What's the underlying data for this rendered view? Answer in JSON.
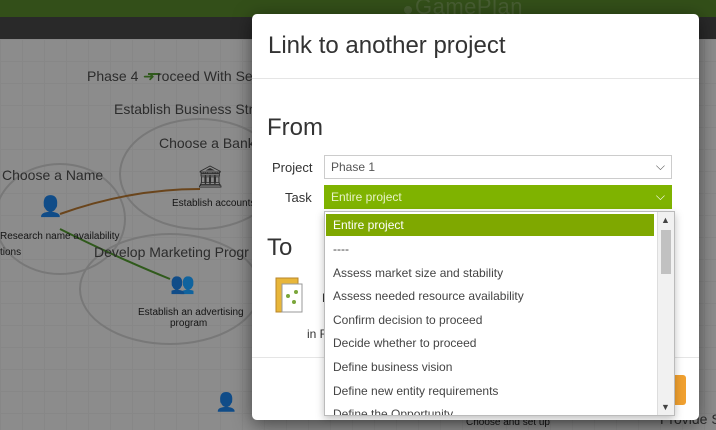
{
  "app": {
    "brand": "GamePlan"
  },
  "background": {
    "phase_label": "Phase 4",
    "proceed_label": "roceed With Se",
    "establish_business": "Establish Business Str",
    "choose_bank": "Choose a Bank",
    "choose_name": "Choose a Name",
    "establish_accounts": "Establish accounts",
    "research_name": "Research name availability",
    "options_frag": "tions",
    "develop_marketing": "Develop Marketing Progr",
    "advertising_line1": "Establish an advertising",
    "advertising_line2": "program",
    "choose_setup": "Choose and set up",
    "provide_frag": "Provide S"
  },
  "modal": {
    "title": "Link to another project",
    "from_heading": "From",
    "project_label": "Project",
    "project_value": "Phase 1",
    "task_label": "Task",
    "task_value": "Entire project",
    "to_heading": "To",
    "to_fragment_1": "F",
    "to_fragment_2": "in F"
  },
  "dropdown": {
    "items": [
      "Entire project",
      "----",
      "Assess market size and stability",
      "Assess needed resource availability",
      "Confirm decision to proceed",
      "Decide whether to proceed",
      "Define business vision",
      "Define new entity requirements",
      "Define the Opportunity"
    ],
    "selected_index": 0
  },
  "colors": {
    "accent_green": "#7fb300",
    "selected_green": "#7fa800",
    "orange_button": "#f0a030"
  }
}
